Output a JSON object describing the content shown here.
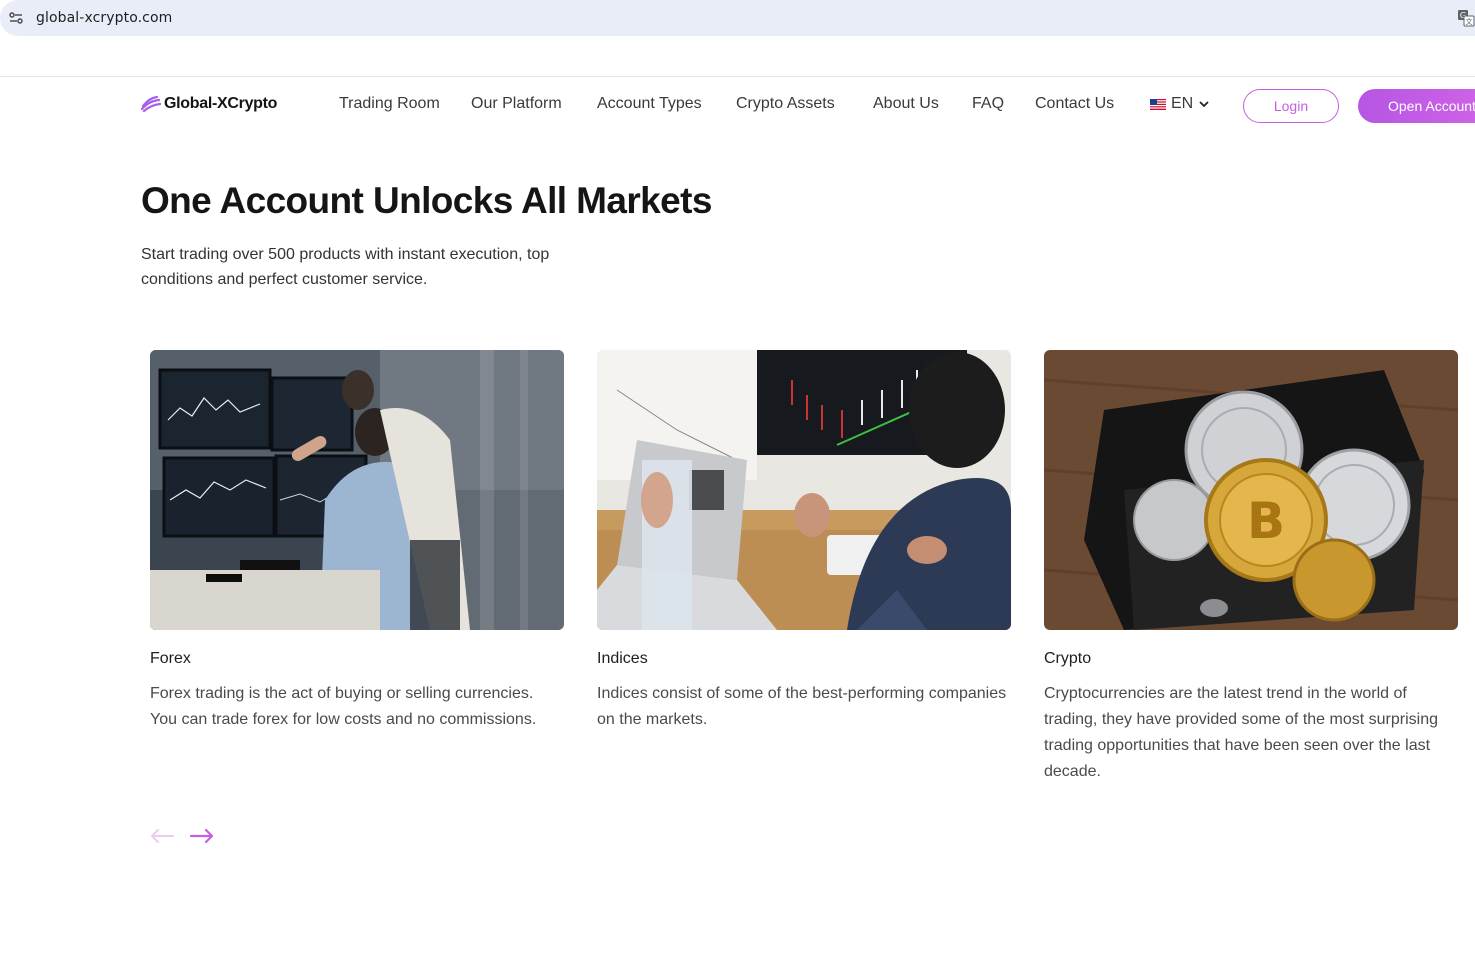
{
  "browser": {
    "url": "global-xcrypto.com"
  },
  "header": {
    "logo_text": "Global-XCrypto",
    "nav": [
      {
        "label": "Trading Room"
      },
      {
        "label": "Our Platform"
      },
      {
        "label": "Account Types"
      },
      {
        "label": "Crypto Assets"
      },
      {
        "label": "About Us"
      },
      {
        "label": "FAQ"
      },
      {
        "label": "Contact Us"
      }
    ],
    "language": "EN",
    "login_label": "Login",
    "open_account_label": "Open Account"
  },
  "hero": {
    "title": "One Account Unlocks All Markets",
    "subtitle": "Start trading over 500 products with instant execution, top conditions and perfect customer service."
  },
  "cards": [
    {
      "title": "Forex",
      "description": "Forex trading is the act of buying or selling currencies. You can trade forex for low costs and no commissions.",
      "image": "traders-at-monitors"
    },
    {
      "title": "Indices",
      "description": "Indices consist of some of the best-performing companies on the markets.",
      "image": "desk-with-charts"
    },
    {
      "title": "Crypto",
      "description": "Cryptocurrencies are the latest trend in the world of trading, they have provided some of the most surprising trading opportunities that have been seen over the last decade.",
      "image": "coins-in-wallet"
    }
  ],
  "colors": {
    "accent": "#c560e0",
    "accent_gradient_start": "#b656e4",
    "accent_gradient_end": "#d164e6",
    "arrow_disabled": "#f0c8f5"
  }
}
